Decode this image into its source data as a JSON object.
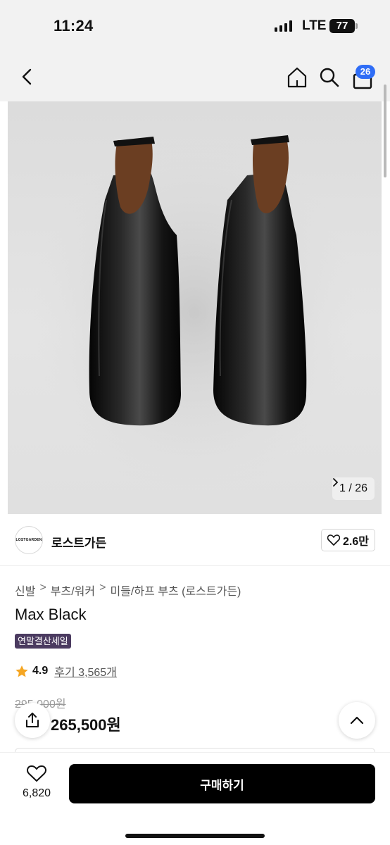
{
  "status_bar": {
    "time": "11:24",
    "network": "LTE",
    "battery": "77"
  },
  "nav": {
    "back_icon": "chevron-left-icon",
    "home_icon": "home-icon",
    "search_icon": "search-icon",
    "cart_icon": "shopping-bag-icon",
    "cart_count": "26"
  },
  "gallery": {
    "current": "1",
    "total": "26",
    "counter_text": "1 / 26",
    "next_icon": "chevron-right-icon"
  },
  "store": {
    "logo_text": "LOSTGARDEN",
    "name": "로스트가든",
    "likes": "2.6만"
  },
  "product": {
    "breadcrumb": [
      "신발",
      "부츠/워커",
      "미들/하프 부츠 (로스트가든)"
    ],
    "breadcrumb_sep": ">",
    "title": "Max Black",
    "sale_tag": "연말결산세일",
    "rating": "4.9",
    "reviews": "후기 3,565개",
    "original_price": "295,000원",
    "price": "265,500원"
  },
  "bottom": {
    "wish_count": "6,820",
    "buy_label": "구매하기"
  },
  "colors": {
    "accent": "#2f6df6",
    "sale_tag": "#4b3b60",
    "star": "#f5a623",
    "buy_button": "#000000"
  }
}
